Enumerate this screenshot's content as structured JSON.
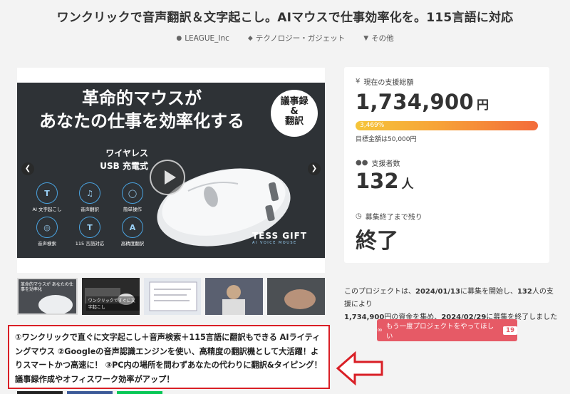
{
  "project": {
    "title": "ワンクリックで音声翻訳＆文字起こし。AIマウスで仕事効率化を。115言語に対応",
    "meta": [
      {
        "icon": "user-icon",
        "label": "LEAGUE_Inc"
      },
      {
        "icon": "tag-icon",
        "label": "テクノロジー・ガジェット"
      },
      {
        "icon": "location-pin-icon",
        "label": "その他"
      }
    ]
  },
  "hero": {
    "headline_line1": "革命的マウスが",
    "headline_line2": "あなたの仕事を効率化する",
    "badge_line1": "議事録",
    "badge_line2": "&",
    "badge_line3": "翻訳",
    "sub1": "ワイヤレス",
    "sub2": "USB 充電式",
    "features": [
      "AI 文字起こし",
      "音声翻訳",
      "簡単操作",
      "音声検索",
      "115 言語対応",
      "高精度翻訳"
    ],
    "brand": "TESS GIFT",
    "brand_sub": "AI VOICE MOUSE"
  },
  "thumbnails": [
    {
      "caption": "革命的マウスが あなたの仕事を効率化"
    },
    {
      "caption": "ワンクリックですぐに文字起こし"
    },
    {
      "caption": ""
    },
    {
      "caption": ""
    },
    {
      "caption": ""
    }
  ],
  "description": "①ワンクリックで直ぐに文字起こし＋音声検索＋115言語に翻訳もできる AIライティングマウス ②Googleの音声認識エンジンを使い、高精度の翻訳機として大活躍！よりスマートかつ高速に！ ③PC内の場所を問わずあなたの代わりに翻訳&タイピング！議事録作成やオフィスワーク効率がアップ！",
  "stats": {
    "total_label": "現在の支援総額",
    "total_amount": "1,734,900",
    "total_unit": "円",
    "progress_text": "3,469%",
    "goal_text": "目標金額は50,000円",
    "backers_label": "支援者数",
    "backers_count": "132",
    "backers_unit": "人",
    "remaining_label": "募集終了まで残り",
    "remaining_value": "終了"
  },
  "summary": {
    "p1": "このプロジェクトは、",
    "start_date": "2024/01/13",
    "p2": "に募集を開始し、",
    "backers": "132",
    "p3": "人の支援により",
    "amount": "1,734,900",
    "p4": "円の資金を集め、",
    "end_date": "2024/02/29",
    "p5": "に募集を終了しました"
  },
  "again_button": {
    "label": "もう一度プロジェクトをやってほしい",
    "count": "19"
  },
  "colors": {
    "accent_red": "#d91f26",
    "button_pink": "#e65a66",
    "progress_start": "#f5c53a",
    "progress_end": "#f36b3a"
  }
}
